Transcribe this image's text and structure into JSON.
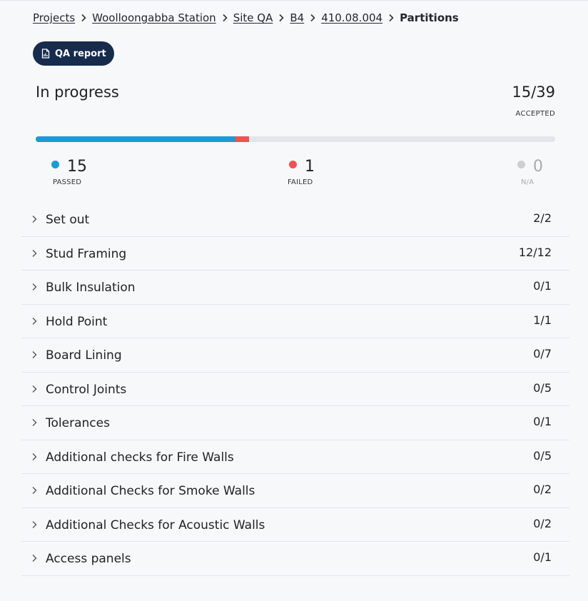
{
  "breadcrumb": {
    "items": [
      "Projects",
      "Woolloongabba Station",
      "Site QA",
      "B4",
      "410.08.004"
    ],
    "current": "Partitions"
  },
  "qa_button": {
    "label": "QA report",
    "icon": "report-chart-icon"
  },
  "status": {
    "title": "In progress",
    "accepted_count": "15/39",
    "accepted_label": "ACCEPTED"
  },
  "progress": {
    "total": 39,
    "passed": 15,
    "failed": 1,
    "colors": {
      "passed": "#1a9bd7",
      "failed": "#f05252",
      "track": "#e4e5ea"
    }
  },
  "stats": {
    "passed": {
      "value": "15",
      "label": "PASSED",
      "color": "#1a9bd7"
    },
    "failed": {
      "value": "1",
      "label": "FAILED",
      "color": "#f05252"
    },
    "na": {
      "value": "0",
      "label": "N/A",
      "color": "#cfcfcf"
    }
  },
  "sections": [
    {
      "name": "Set out",
      "count": "2/2"
    },
    {
      "name": "Stud Framing",
      "count": "12/12"
    },
    {
      "name": "Bulk Insulation",
      "count": "0/1"
    },
    {
      "name": "Hold Point",
      "count": "1/1"
    },
    {
      "name": "Board Lining",
      "count": "0/7"
    },
    {
      "name": "Control Joints",
      "count": "0/5"
    },
    {
      "name": "Tolerances",
      "count": "0/1"
    },
    {
      "name": "Additional checks for Fire Walls",
      "count": "0/5"
    },
    {
      "name": "Additional Checks for Smoke Walls",
      "count": "0/2"
    },
    {
      "name": "Additional Checks for Acoustic Walls",
      "count": "0/2"
    },
    {
      "name": "Access panels",
      "count": "0/1"
    }
  ]
}
